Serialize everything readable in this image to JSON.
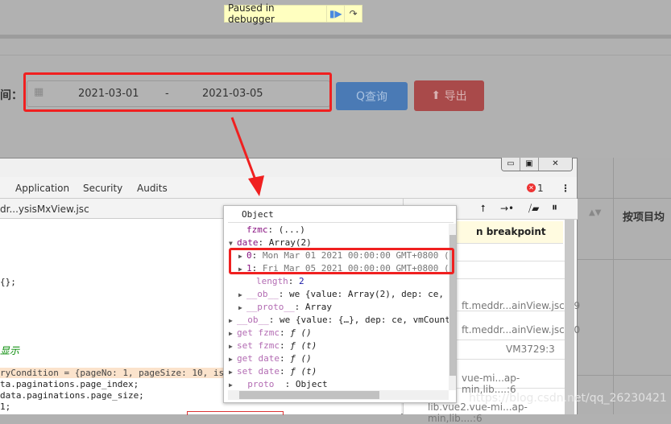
{
  "debugger_banner": {
    "text": "Paused in debugger",
    "resume_icon": "resume-icon",
    "step_icon": "step-over-icon"
  },
  "filter": {
    "label": "间：",
    "start_date": "2021-03-01",
    "separator": "-",
    "end_date": "2021-03-05",
    "query_label": "查询",
    "export_label": "导出"
  },
  "devtools": {
    "tabs": [
      "Application",
      "Security",
      "Audits"
    ],
    "error_count": "1",
    "file_tab": "dr...ysisMxView.jsc",
    "code_lines": [
      {
        "text": "{};",
        "style": "normal"
      },
      {
        "text": "显示",
        "style": "comment"
      },
      {
        "text": "ryCondition = {pageNo: 1, pageSize: 10, is",
        "style": "highlight"
      },
      {
        "text": "ta.paginations.page_index;",
        "style": "normal"
      },
      {
        "text": "data.paginations.page_size;",
        "style": "normal"
      },
      {
        "text": "1;",
        "style": "normal"
      }
    ],
    "right_panel": {
      "paused_text": "n breakpoint",
      "callstack": [
        "ft.meddr...ainView.jsc:69",
        "ft.meddr...ainView.jsc:50",
        "VM3729:3",
        "vue-mi...ap-min,lib....:6",
        "lib.vue2.vue-mi...ap-min,lib....:6"
      ]
    }
  },
  "popup": {
    "title": "Object",
    "lines": [
      {
        "indent": 1,
        "arrow": "",
        "key": "fzmc",
        "sep": ": ",
        "val": "(...)"
      },
      {
        "indent": 0,
        "arrow": "▼",
        "key": "date",
        "sep": ": ",
        "val": "Array(2)"
      },
      {
        "indent": 1,
        "arrow": "▶",
        "key": "0",
        "sep": ": ",
        "val": "Mon Mar 01 2021 00:00:00 GMT+0800 (",
        "valstyle": "gray"
      },
      {
        "indent": 1,
        "arrow": "▶",
        "key": "1",
        "sep": ": ",
        "val": "Fri Mar 05 2021 00:00:00 GMT+0800 (",
        "valstyle": "gray"
      },
      {
        "indent": 2,
        "arrow": "",
        "key": "length",
        "sep": ": ",
        "val": "2",
        "valstyle": "blue",
        "keystyle": "lp"
      },
      {
        "indent": 1,
        "arrow": "▶",
        "key": "__ob__",
        "sep": ": ",
        "val": "we {value: Array(2), dep: ce,",
        "keystyle": "lp"
      },
      {
        "indent": 1,
        "arrow": "▶",
        "key": "__proto__",
        "sep": ": ",
        "val": "Array",
        "keystyle": "lp"
      },
      {
        "indent": 0,
        "arrow": "▶",
        "key": "__ob__",
        "sep": ": ",
        "val": "we {value: {…}, dep: ce, vmCount",
        "keystyle": "lp"
      },
      {
        "indent": 0,
        "arrow": "▶",
        "key": "get fzmc",
        "sep": ": ",
        "val": "ƒ ()",
        "keystyle": "lp"
      },
      {
        "indent": 0,
        "arrow": "▶",
        "key": "set fzmc",
        "sep": ": ",
        "val": "ƒ (t)",
        "keystyle": "lp"
      },
      {
        "indent": 0,
        "arrow": "▶",
        "key": "get date",
        "sep": ": ",
        "val": "ƒ ()",
        "keystyle": "lp"
      },
      {
        "indent": 0,
        "arrow": "▶",
        "key": "set date",
        "sep": ": ",
        "val": "ƒ (t)",
        "keystyle": "lp"
      },
      {
        "indent": 0,
        "arrow": "▶",
        "key": "  proto  ",
        "sep": ": ",
        "val": "Object",
        "keystyle": "lp"
      }
    ]
  },
  "page_table": {
    "header": "按项目均"
  },
  "watermark": "https://blog.csdn.net/qq_26230421",
  "colors": {
    "highlight_box": "#f02020",
    "query_button": "#4a7ab5",
    "export_button": "#a94a4a",
    "banner": "#ffffc0"
  }
}
